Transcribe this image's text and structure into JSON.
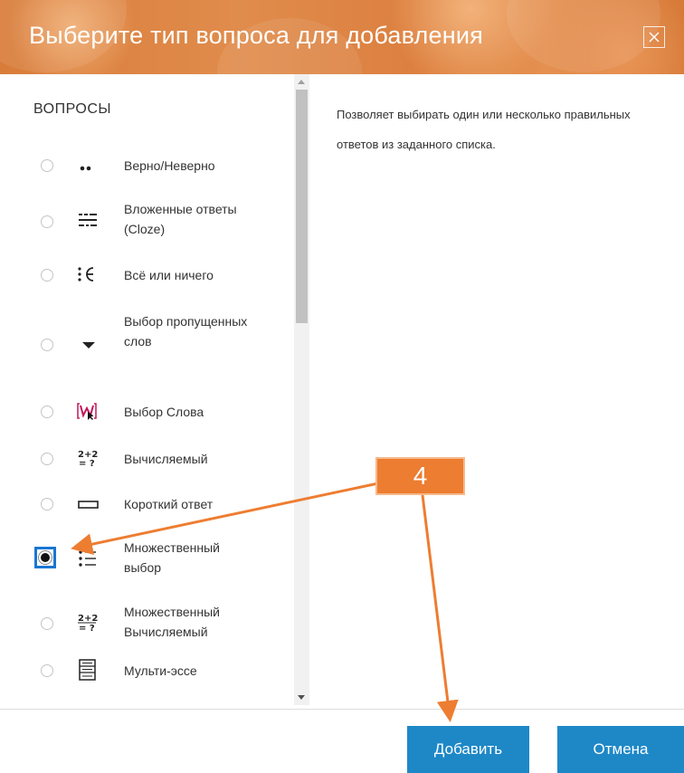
{
  "dialog": {
    "title": "Выберите тип вопроса для добавления",
    "close_icon": "close-icon"
  },
  "questions": {
    "section_title": "ВОПРОСЫ",
    "items": [
      {
        "label": "Верно/Неверно",
        "icon": "true-false-icon",
        "selected": false
      },
      {
        "label": "Вложенные ответы (Cloze)",
        "icon": "cloze-icon",
        "selected": false
      },
      {
        "label": "Всё или ничего",
        "icon": "all-or-nothing-icon",
        "selected": false
      },
      {
        "label": "Выбор пропущенных слов",
        "icon": "dropdown-icon",
        "selected": false
      },
      {
        "label": "Выбор Слова",
        "icon": "select-word-icon",
        "selected": false
      },
      {
        "label": "Вычисляемый",
        "icon": "calculated-icon",
        "selected": false
      },
      {
        "label": "Короткий ответ",
        "icon": "short-answer-icon",
        "selected": false
      },
      {
        "label": "Множественный выбор",
        "icon": "multichoice-icon",
        "selected": true
      },
      {
        "label": "Множественный Вычисляемый",
        "icon": "calculated-multi-icon",
        "selected": false
      },
      {
        "label": "Мульти-эссе",
        "icon": "multi-essay-icon",
        "selected": false
      }
    ]
  },
  "description": "Позволяет выбирать один или несколько правильных ответов из заданного списка.",
  "buttons": {
    "add_label": "Добавить",
    "cancel_label": "Отмена"
  },
  "annotation": {
    "callout_label": "4"
  },
  "colors": {
    "header": "#dd8444",
    "primary_button": "#1e88c7",
    "callout": "#ed7d31",
    "selected_radio_border": "#1976d2"
  }
}
